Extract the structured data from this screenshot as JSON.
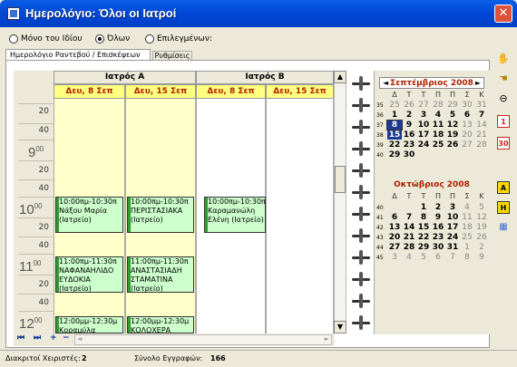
{
  "window": {
    "title": "Ημερολόγιο: Όλοι οι Ιατροί",
    "close": "✕"
  },
  "filter": {
    "options": [
      {
        "label": "Μόνο του Ιδίου",
        "selected": false
      },
      {
        "label": "Όλων",
        "selected": true
      },
      {
        "label": "Επιλεγμένων:",
        "selected": false
      }
    ]
  },
  "tabs": {
    "appointments": "Ημερολόγιο Ραντεβού / Επισκέψεων",
    "settings": "Ρυθμίσεις"
  },
  "doctors": [
    {
      "name": "Ιατρός A",
      "days": [
        "Δευ, 8 Σεπ",
        "Δευ, 15 Σεπ"
      ]
    },
    {
      "name": "Ιατρός B",
      "days": [
        "Δευ, 8 Σεπ",
        "Δευ, 15 Σεπ"
      ]
    }
  ],
  "timeslots": {
    "m20a": "20",
    "m40a": "40",
    "h9": "9",
    "h9m": "00",
    "m20b": "20",
    "m40b": "40",
    "h10": "10",
    "h10m": "00",
    "m20c": "20",
    "m40c": "40",
    "h11": "11",
    "h11m": "00",
    "m20d": "20",
    "m40d": "40",
    "h12": "12",
    "h12m": "00"
  },
  "appointments": {
    "a1": {
      "time": "10:00πμ-10:30π",
      "name": "Νάξου Μαρία",
      "place": "(Ιατρείο)"
    },
    "a2": {
      "time": "10:00πμ-10:30π",
      "name": "ΠΕΡΙΣΤΑΣΙΑΚΑ",
      "place": "(Ιατρείο)"
    },
    "a3": {
      "time": "10:00πμ-10:30π",
      "name": "Καραμανώλη",
      "place": "Ελένη (Ιατρείο)"
    },
    "a4": {
      "time": "11:00πμ-11:30π",
      "name": "ΝΑΦΑΝΑΗΛΙΔΟ",
      "place": "ΕΥΔΟΚΙΑ",
      "extra": "(Ιατρείο)"
    },
    "a5": {
      "time": "11:00πμ-11:30π",
      "name": "ΑΝΑΣΤΑΣΙΑΔΗ",
      "place": "ΣΤΑΜΑΤΙΝΑ",
      "extra": "(Ιατρείο)"
    },
    "a6": {
      "time": "12:00μμ-12:30μ",
      "name": "Κοραμύλα"
    },
    "a7": {
      "time": "12:00μμ-12:30μ",
      "name": "ΚΟΛΟΧΕΡΑ"
    }
  },
  "nav": {
    "first": "⏮",
    "last": "⏭",
    "add": "+",
    "remove": "−",
    "scroll_left": "◄",
    "scroll_right": "►"
  },
  "mini_calendar": {
    "september": {
      "title": "Σεπτέμβριος 2008",
      "prev": "◄",
      "next": "►",
      "dow": [
        "Δ",
        "Τ",
        "Τ",
        "Π",
        "Π",
        "Σ",
        "Κ"
      ],
      "weeks": [
        {
          "no": "35",
          "days": [
            "25",
            "26",
            "27",
            "28",
            "29",
            "30",
            "31"
          ]
        },
        {
          "no": "36",
          "days": [
            "1",
            "2",
            "3",
            "4",
            "5",
            "6",
            "7"
          ]
        },
        {
          "no": "37",
          "days": [
            "8",
            "9",
            "10",
            "11",
            "12",
            "13",
            "14"
          ]
        },
        {
          "no": "38",
          "days": [
            "15",
            "16",
            "17",
            "18",
            "19",
            "20",
            "21"
          ]
        },
        {
          "no": "39",
          "days": [
            "22",
            "23",
            "24",
            "25",
            "26",
            "27",
            "28"
          ]
        },
        {
          "no": "40",
          "days": [
            "29",
            "30"
          ]
        }
      ]
    },
    "october": {
      "title": "Οκτώβριος 2008",
      "dow": [
        "Δ",
        "Τ",
        "Τ",
        "Π",
        "Π",
        "Σ",
        "Κ"
      ],
      "weeks": [
        {
          "no": "40",
          "days": [
            "",
            "",
            "1",
            "2",
            "3",
            "4",
            "5"
          ]
        },
        {
          "no": "41",
          "days": [
            "6",
            "7",
            "8",
            "9",
            "10",
            "11",
            "12"
          ]
        },
        {
          "no": "42",
          "days": [
            "13",
            "14",
            "15",
            "16",
            "17",
            "18",
            "19"
          ]
        },
        {
          "no": "43",
          "days": [
            "20",
            "21",
            "22",
            "23",
            "24",
            "25",
            "26"
          ]
        },
        {
          "no": "44",
          "days": [
            "27",
            "28",
            "29",
            "30",
            "31",
            "1",
            "2"
          ]
        },
        {
          "no": "45",
          "days": [
            "3",
            "4",
            "5",
            "6",
            "7",
            "8",
            "9"
          ]
        }
      ]
    }
  },
  "toolbar": {
    "day1": "1",
    "day30": "30",
    "a": "A",
    "h": "H"
  },
  "status": {
    "users_label": "Διακριτοί Χειριστές:",
    "users_value": "2",
    "records_label": "Σύνολο Εγγραφών:",
    "records_value": "166"
  }
}
